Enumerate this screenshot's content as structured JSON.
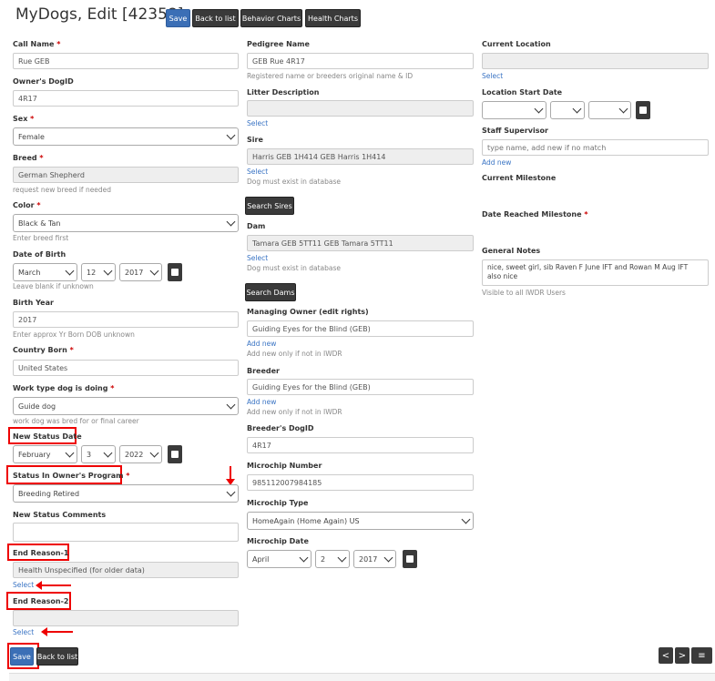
{
  "header": {
    "title": "MyDogs, Edit [42358]",
    "save_label": "Save",
    "back_label": "Back to list",
    "behavior_label": "Behavior Charts",
    "health_label": "Health Charts"
  },
  "col1": {
    "call_name": {
      "label": "Call Name",
      "value": "Rue GEB"
    },
    "owners_dogid": {
      "label": "Owner's DogID",
      "value": "4R17"
    },
    "sex": {
      "label": "Sex",
      "value": "Female"
    },
    "breed": {
      "label": "Breed",
      "value": "German Shepherd",
      "help": "request new breed if needed"
    },
    "color": {
      "label": "Color",
      "value": "Black & Tan",
      "help": "Enter breed first"
    },
    "dob": {
      "label": "Date of Birth",
      "month": "March",
      "day": "12",
      "year": "2017",
      "help": "Leave blank if unknown"
    },
    "birth_year": {
      "label": "Birth Year",
      "value": "2017",
      "help": "Enter approx Yr Born DOB unknown"
    },
    "country_born": {
      "label": "Country Born",
      "value": "United States"
    },
    "work_type": {
      "label": "Work type dog is doing",
      "value": "Guide dog",
      "help": "work dog was bred for or final career"
    },
    "new_status_date": {
      "label": "New Status Date",
      "month": "February",
      "day": "3",
      "year": "2022"
    },
    "status_program": {
      "label": "Status In Owner's Program",
      "value": "Breeding Retired"
    },
    "new_status_comments": {
      "label": "New Status Comments",
      "value": ""
    },
    "end_reason1": {
      "label": "End Reason-1",
      "value": "Health Unspecified (for older data)",
      "link": "Select"
    },
    "end_reason2": {
      "label": "End Reason-2",
      "value": "",
      "link": "Select"
    }
  },
  "col2": {
    "pedigree_name": {
      "label": "Pedigree Name",
      "value": "GEB Rue 4R17",
      "help": "Registered name or breeders original name & ID"
    },
    "litter_desc": {
      "label": "Litter Description",
      "value": "",
      "link": "Select"
    },
    "sire": {
      "label": "Sire",
      "value": "Harris GEB 1H414 GEB Harris 1H414",
      "link": "Select",
      "help": "Dog must exist in database",
      "button": "Search Sires"
    },
    "dam": {
      "label": "Dam",
      "value": "Tamara GEB 5TT11 GEB Tamara 5TT11",
      "link": "Select",
      "help": "Dog must exist in database",
      "button": "Search Dams"
    },
    "managing_owner": {
      "label": "Managing Owner (edit rights)",
      "value": "Guiding Eyes for the Blind (GEB)",
      "link": "Add new",
      "help": "Add new only if not in IWDR"
    },
    "breeder": {
      "label": "Breeder",
      "value": "Guiding Eyes for the Blind (GEB)",
      "link": "Add new",
      "help": "Add new only if not in IWDR"
    },
    "breeders_dogid": {
      "label": "Breeder's DogID",
      "value": "4R17"
    },
    "microchip_number": {
      "label": "Microchip Number",
      "value": "985112007984185"
    },
    "microchip_type": {
      "label": "Microchip Type",
      "value": "HomeAgain (Home Again) US"
    },
    "microchip_date": {
      "label": "Microchip Date",
      "month": "April",
      "day": "2",
      "year": "2017"
    }
  },
  "col3": {
    "current_location": {
      "label": "Current Location",
      "value": "",
      "link": "Select"
    },
    "location_start": {
      "label": "Location Start Date"
    },
    "staff_supervisor": {
      "label": "Staff Supervisor",
      "placeholder": "type name, add new if no match",
      "link": "Add new"
    },
    "current_milestone": {
      "label": "Current Milestone"
    },
    "date_milestone": {
      "label": "Date Reached Milestone"
    },
    "general_notes": {
      "label": "General Notes",
      "value": "nice, sweet girl, sib Raven F June IFT and Rowan M  Aug IFT also nice",
      "help": "Visible to all IWDR Users"
    }
  },
  "footer": {
    "save_label": "Save",
    "back_label": "Back to list",
    "prev": "<",
    "next": ">",
    "menu": "≡"
  },
  "colors": {
    "primary": "#3b6fb6",
    "dark": "#3a3a3a",
    "highlight": "#ee0000"
  }
}
